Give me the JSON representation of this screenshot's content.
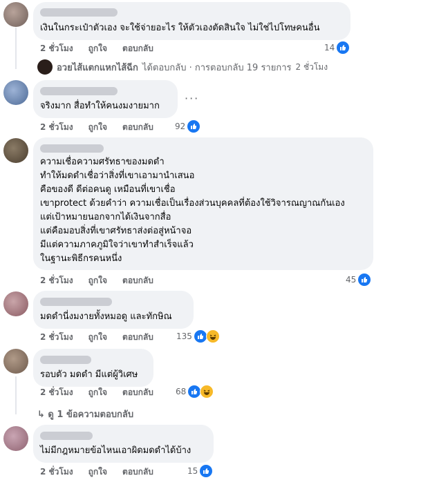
{
  "comments": [
    {
      "text": "เงินในกระเป๋าตัวเอง จะใช้จ่ายอะไร ให้ตัวเองตัดสินใจ ไม่ใช่ไปโทษคนอื่น",
      "time": "2 ชั่วโมง",
      "like_label": "ถูกใจ",
      "reply_label": "ตอบกลับ",
      "reactions": "14"
    },
    {
      "text": "จริงมาก สื่อทำให้คนงมงายมาก",
      "time": "2 ชั่วโมง",
      "like_label": "ถูกใจ",
      "reply_label": "ตอบกลับ",
      "reactions": "92"
    },
    {
      "text": "ความเชื่อความศรัทธาของมดดำ\nทำให้มดดำเชื่อว่าสิ่งที่เขาเอามานำเสนอ\nคือของดี ดีต่อคนดู เหมือนที่เขาเชื่อ\nเขาprotect ด้วยคำว่า ความเชื่อเป็นเรื่องส่วนบุคคลที่ต้องใช้วิจารณญาณกันเอง\nแต่เป้าหมายนอกจากได้เงินจากสื่อ\nแต่คือมอบสิ่งที่เขาศรัทธาส่งต่อสู่หน้าจอ\nมีแต่ความภาคภูมิใจว่าเขาทำสำเร็จแล้ว\nในฐานะพิธีกรคนหนึ่ง",
      "time": "2 ชั่วโมง",
      "like_label": "ถูกใจ",
      "reply_label": "ตอบกลับ",
      "reactions": "45"
    },
    {
      "text": "มดดำนี่งมงายทั้งหมอดู และทักษิณ",
      "time": "2 ชั่วโมง",
      "like_label": "ถูกใจ",
      "reply_label": "ตอบกลับ",
      "reactions": "135"
    },
    {
      "text": "รอบตัว มดดำ มีแต่ผู้วิเศษ",
      "time": "2 ชั่วโมง",
      "like_label": "ถูกใจ",
      "reply_label": "ตอบกลับ",
      "reactions": "68"
    },
    {
      "text": "ไม่มีกฎหมายข้อไหนเอาผิดมดดำได้บ้าง",
      "time": "2 ชั่วโมง",
      "like_label": "ถูกใจ",
      "reply_label": "ตอบกลับ",
      "reactions": "15"
    }
  ],
  "reply_summary": {
    "name": "อวยไส้แตกแหกไส้ฉีก",
    "text": "ได้ตอบกลับ · การตอบกลับ 19 รายการ",
    "time": "2 ชั่วโมง"
  },
  "more_replies": "ดู 1 ข้อความตอบกลับ",
  "colors": {
    "like": "#1877f2",
    "haha": "#f7b928",
    "bubble": "#f0f2f5",
    "meta": "#65676b"
  },
  "icons": [
    "like-icon",
    "haha-icon",
    "more-icon",
    "reply-arrow-icon"
  ]
}
